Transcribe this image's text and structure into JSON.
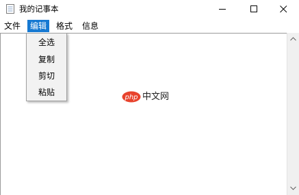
{
  "window": {
    "title": "我的记事本",
    "icon": "notepad-app-icon",
    "controls": [
      "minimize-icon",
      "maximize-icon",
      "close-icon"
    ]
  },
  "menubar": {
    "items": [
      {
        "label": "文件",
        "active": false
      },
      {
        "label": "编辑",
        "active": true
      },
      {
        "label": "格式",
        "active": false
      },
      {
        "label": "信息",
        "active": false
      }
    ]
  },
  "edit_menu": {
    "items": [
      "全选",
      "复制",
      "剪切",
      "粘贴"
    ]
  },
  "watermark": {
    "logo_text": "php",
    "text": "中文网"
  },
  "colors": {
    "menu_highlight": "#1679d2",
    "watermark_logo": "#e8432d"
  }
}
